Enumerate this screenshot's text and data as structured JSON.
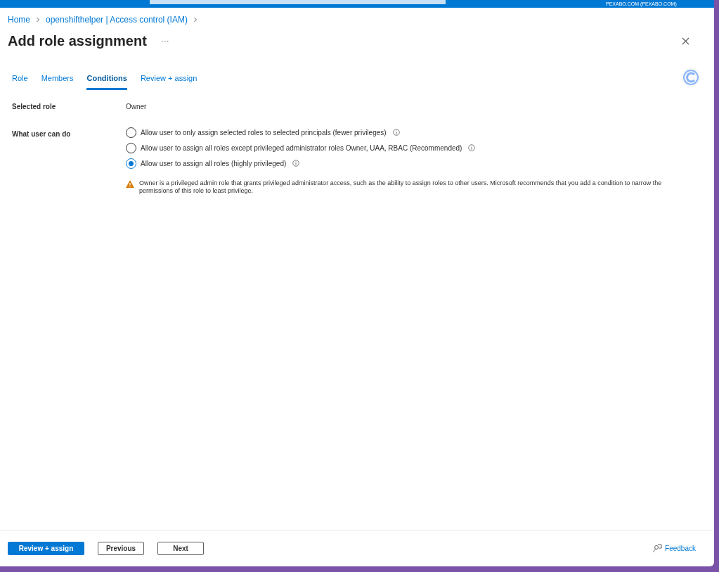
{
  "top_bar": {
    "account": "PEXABO.COM (PEXABO.COM)"
  },
  "breadcrumb": [
    "Home",
    "openshifthelper | Access control (IAM)"
  ],
  "title": "Add role assignment",
  "more": "···",
  "tabs": [
    {
      "label": "Role",
      "selected": false
    },
    {
      "label": "Members",
      "selected": false
    },
    {
      "label": "Conditions",
      "selected": true
    },
    {
      "label": "Review + assign",
      "selected": false
    }
  ],
  "selected_role": {
    "label": "Selected role",
    "value": "Owner"
  },
  "what_user_can_do": {
    "label": "What user can do",
    "options": [
      {
        "label": "Allow user to only assign selected roles to selected principals (fewer privileges)",
        "selected": false
      },
      {
        "label": "Allow user to assign all roles except privileged administrator roles Owner, UAA, RBAC (Recommended)",
        "selected": false
      },
      {
        "label": "Allow user to assign all roles (highly privileged)",
        "selected": true
      }
    ]
  },
  "warning": "Owner is a privileged admin role that grants privileged administrator access, such as the ability to assign roles to other users. Microsoft recommends that you add a condition to narrow the permissions of this role to least privilege.",
  "footer": {
    "buttons": [
      {
        "label": "Review + assign",
        "kind": "primary"
      },
      {
        "label": "Previous",
        "kind": "secondary"
      },
      {
        "label": "Next",
        "kind": "secondary"
      }
    ],
    "feedback": "Feedback"
  }
}
